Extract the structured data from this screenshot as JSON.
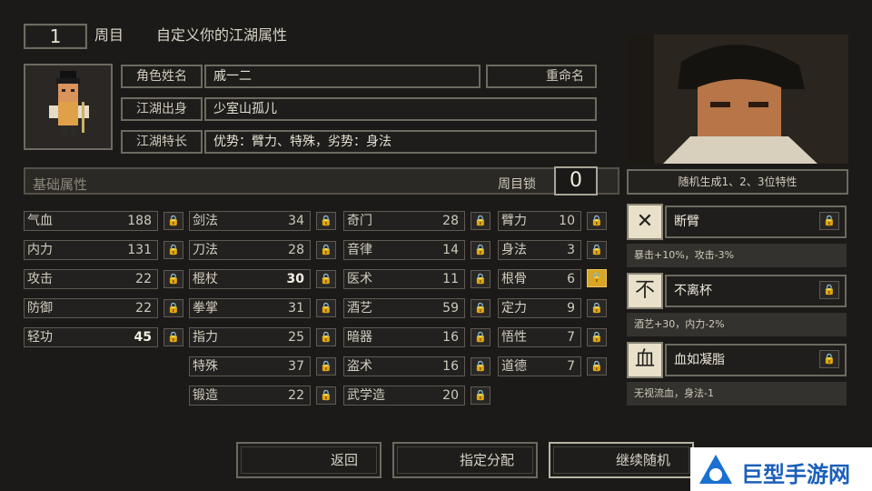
{
  "header": {
    "round_value": "1",
    "round_label": "周目",
    "title": "自定义你的江湖属性"
  },
  "character": {
    "name_label": "角色姓名",
    "name_value": "戚一二",
    "rename_button": "重命名",
    "origin_label": "江湖出身",
    "origin_value": "少室山孤儿",
    "specialty_label": "江湖特长",
    "specialty_value": "优势：臂力、特殊，劣势：身法"
  },
  "attributes": {
    "section_title": "基础属性",
    "lock_label": "周目锁",
    "lock_count": "0",
    "columns": [
      [
        {
          "name": "气血",
          "value": "188"
        },
        {
          "name": "内力",
          "value": "131"
        },
        {
          "name": "攻击",
          "value": "22"
        },
        {
          "name": "防御",
          "value": "22"
        },
        {
          "name": "轻功",
          "value": "45"
        }
      ],
      [
        {
          "name": "剑法",
          "value": "34"
        },
        {
          "name": "刀法",
          "value": "28"
        },
        {
          "name": "棍杖",
          "value": "30"
        },
        {
          "name": "拳掌",
          "value": "31"
        },
        {
          "name": "指力",
          "value": "25"
        },
        {
          "name": "特殊",
          "value": "37"
        },
        {
          "name": "锻造",
          "value": "22"
        }
      ],
      [
        {
          "name": "奇门",
          "value": "28"
        },
        {
          "name": "音律",
          "value": "14"
        },
        {
          "name": "医术",
          "value": "11"
        },
        {
          "name": "酒艺",
          "value": "59"
        },
        {
          "name": "暗器",
          "value": "16"
        },
        {
          "name": "盗术",
          "value": "16"
        },
        {
          "name": "武学造",
          "value": "20"
        }
      ],
      [
        {
          "name": "臂力",
          "value": "10"
        },
        {
          "name": "身法",
          "value": "3"
        },
        {
          "name": "根骨",
          "value": "6"
        },
        {
          "name": "定力",
          "value": "9"
        },
        {
          "name": "悟性",
          "value": "7"
        },
        {
          "name": "道德",
          "value": "7"
        }
      ]
    ]
  },
  "traits": {
    "header": "随机生成1、2、3位特性",
    "items": [
      {
        "icon_char": "✕",
        "name": "断臂",
        "desc": "暴击+10%，攻击-3%"
      },
      {
        "icon_char": "不",
        "name": "不离杯",
        "desc": "酒艺+30，内力-2%"
      },
      {
        "icon_char": "血",
        "name": "血如凝脂",
        "desc": "无视流血，身法-1"
      }
    ]
  },
  "buttons": {
    "back": "返回",
    "assign": "指定分配",
    "reroll": "继续随机"
  },
  "watermark": {
    "text": "巨型手游网"
  },
  "colors": {
    "lock_active": "#d9a528",
    "frame": "#6e6a60",
    "background": "#1b1a18"
  }
}
